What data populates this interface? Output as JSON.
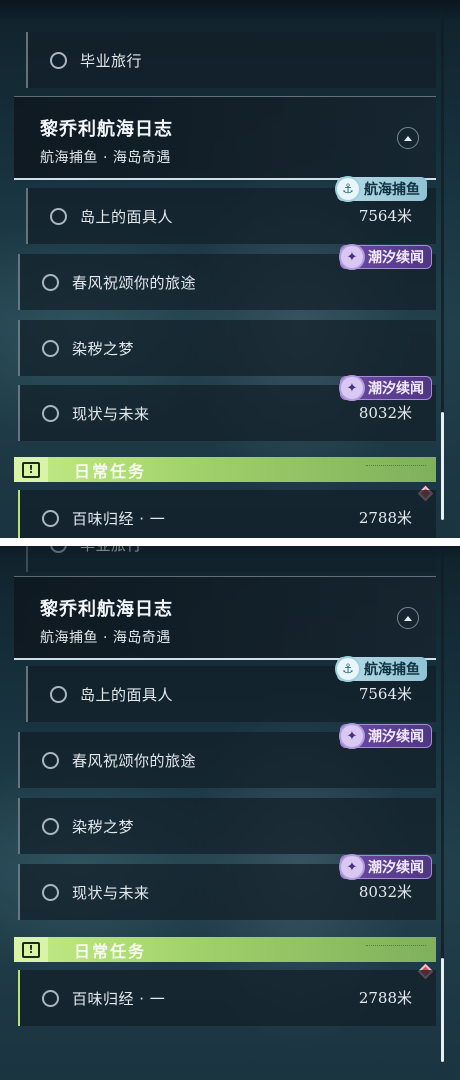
{
  "top_panel": {
    "prev_quest_label": "毕业旅行",
    "header": {
      "title": "黎乔利航海日志",
      "subtitle": "航海捕鱼 · 海岛奇遇"
    },
    "quests": [
      {
        "label": "岛上的面具人",
        "distance": "7564米",
        "badge": "航海捕鱼",
        "badge_icon": "anchor-icon"
      },
      {
        "label": "春风祝颂你的旅途",
        "distance": "",
        "badge": "潮汐续闻",
        "badge_icon": "tide-icon"
      },
      {
        "label": "染秽之梦",
        "distance": "",
        "badge": "",
        "badge_icon": ""
      },
      {
        "label": "现状与未来",
        "distance": "8032米",
        "badge": "潮汐续闻",
        "badge_icon": "tide-icon"
      }
    ],
    "daily": {
      "label": "日常任务",
      "warn_glyph": "!",
      "first_item_label": "百味归经 · 一",
      "first_item_distance": "2788米"
    }
  },
  "bottom_panel": {
    "prev_quest_label": "毕业旅行",
    "header": {
      "title": "黎乔利航海日志",
      "subtitle": "航海捕鱼 · 海岛奇遇"
    },
    "quests": [
      {
        "label": "岛上的面具人",
        "distance": "7564米",
        "badge": "航海捕鱼",
        "badge_icon": "anchor-icon"
      },
      {
        "label": "春风祝颂你的旅途",
        "distance": "",
        "badge": "潮汐续闻",
        "badge_icon": "tide-icon"
      },
      {
        "label": "染秽之梦",
        "distance": "",
        "badge": "",
        "badge_icon": ""
      },
      {
        "label": "现状与未来",
        "distance": "8032米",
        "badge": "潮汐续闻",
        "badge_icon": "tide-icon"
      }
    ],
    "daily": {
      "label": "日常任务",
      "warn_glyph": "!",
      "item_label": "百味归经 · 一",
      "item_distance": "2788米"
    }
  },
  "colors": {
    "daily_accent": "#b6e27a",
    "tide_badge": "#5b3e90",
    "fishing_badge": "#a6d2e0",
    "marker_red": "#e04a5a"
  }
}
